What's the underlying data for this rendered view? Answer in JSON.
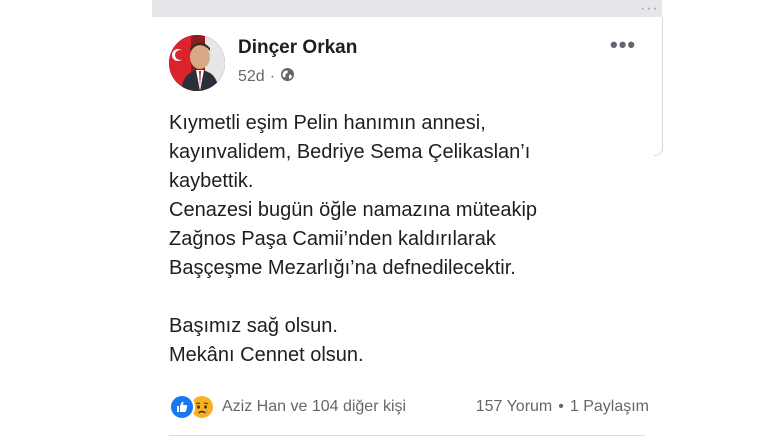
{
  "post": {
    "author": "Dinçer Orkan",
    "time": "52d",
    "privacy_separator": "·",
    "privacy_icon": "globe-icon",
    "more_label": "•••",
    "text_lines": [
      "Kıymetli eşim Pelin hanımın annesi,",
      "kayınvalidem, Bedriye Sema Çelikaslan’ı",
      "kaybettik.",
      "Cenazesi bugün öğle namazına müteakip",
      "Zağnos Paşa Camii’nden kaldırılarak",
      "Başçeşme Mezarlığı’na defnedilecektir."
    ],
    "text_lines_2": [
      "Başımız sağ olsun.",
      "Mekânı Cennet olsun."
    ]
  },
  "footer": {
    "reaction_icons": [
      "like-icon",
      "sad-icon"
    ],
    "reactors": "Aziz Han ve 104 diğer kişi",
    "comments": "157 Yorum",
    "separator": "•",
    "shares": "1 Paylaşım"
  },
  "colors": {
    "like": "#1877f2",
    "sad": "#f7b125",
    "text": "#1c1e21",
    "muted": "#65676b"
  }
}
